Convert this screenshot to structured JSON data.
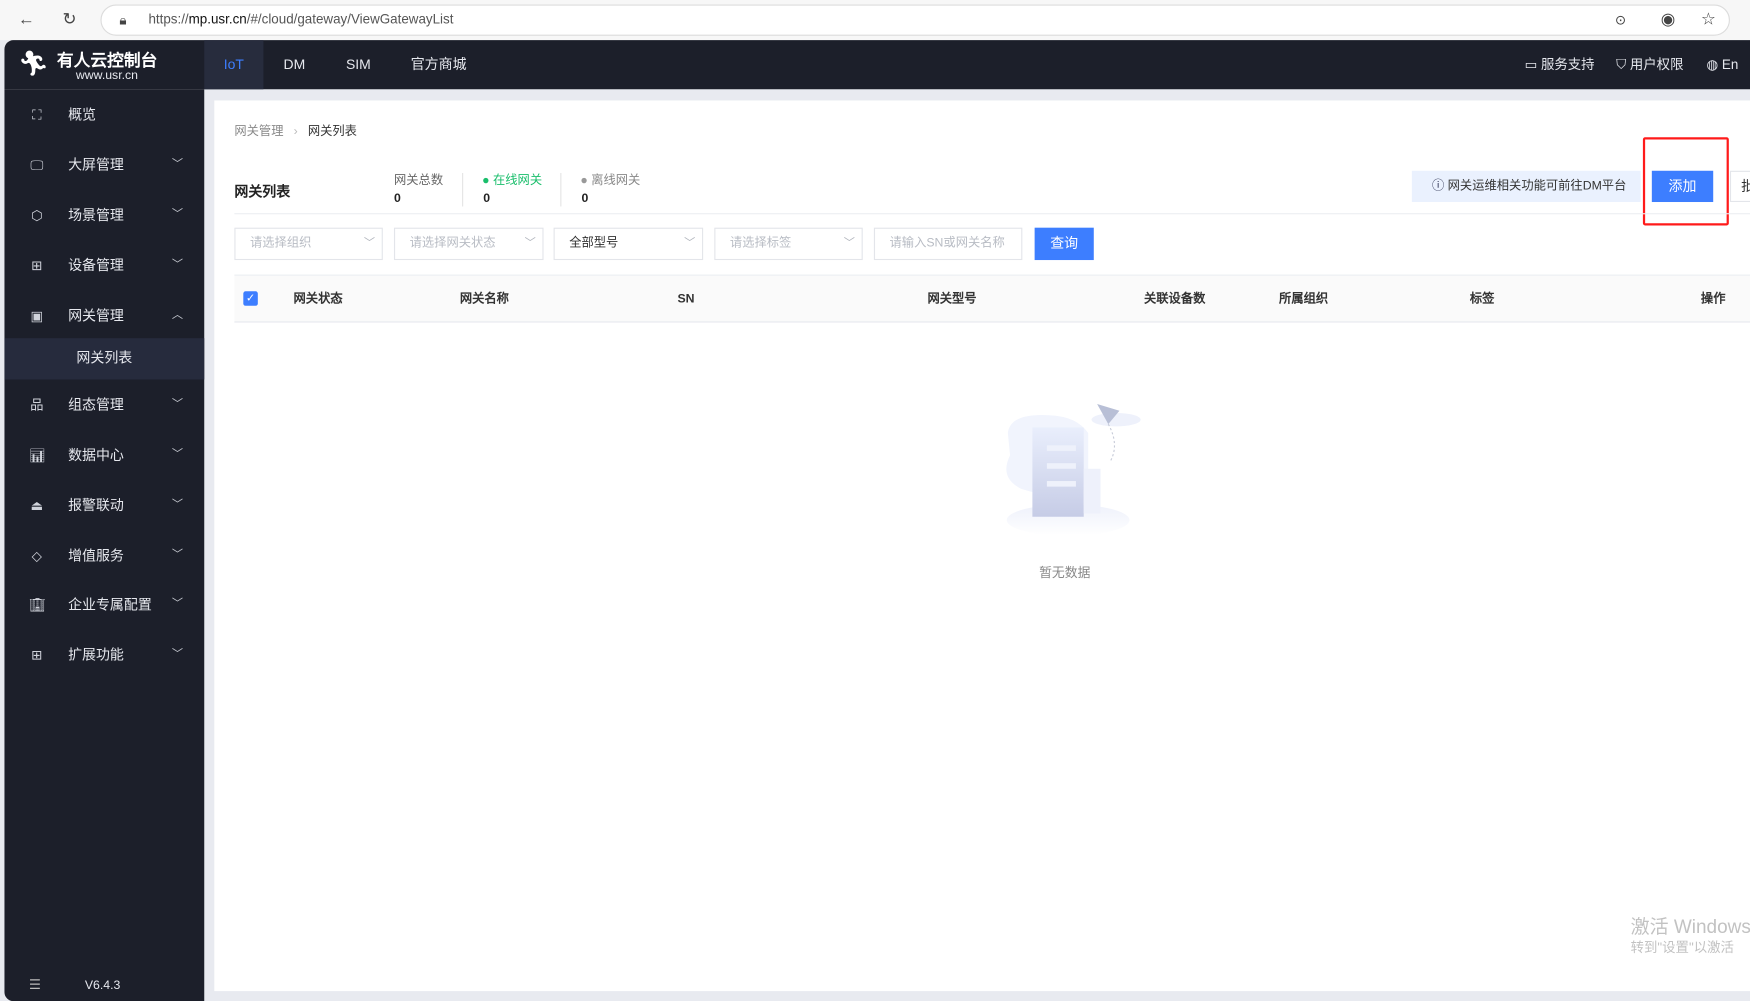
{
  "browser": {
    "url_prefix": "https://",
    "url_host": "mp.usr.cn",
    "url_path": "/#/cloud/gateway/ViewGatewayList"
  },
  "logo": {
    "name": "有人云控制台",
    "site": "www.usr.cn"
  },
  "topnav": {
    "tabs": [
      {
        "label": "IoT",
        "active": true
      },
      {
        "label": "DM"
      },
      {
        "label": "SIM"
      },
      {
        "label": "官方商城"
      }
    ],
    "right": [
      {
        "label": "服务支持",
        "icon": "chat-icon"
      },
      {
        "label": "用户权限",
        "icon": "shield-icon"
      },
      {
        "label": "En",
        "icon": "globe-icon"
      }
    ]
  },
  "sidebar": {
    "items": [
      {
        "label": "概览",
        "icon": "overview-icon"
      },
      {
        "label": "大屏管理",
        "icon": "monitor-icon"
      },
      {
        "label": "场景管理",
        "icon": "cube-icon"
      },
      {
        "label": "设备管理",
        "icon": "device-icon"
      },
      {
        "label": "网关管理",
        "icon": "chart-icon",
        "expanded": true
      },
      {
        "label": "组态管理",
        "icon": "hierarchy-icon"
      },
      {
        "label": "数据中心",
        "icon": "bar-chart-icon"
      },
      {
        "label": "报警联动",
        "icon": "alarm-icon"
      },
      {
        "label": "增值服务",
        "icon": "diamond-icon"
      },
      {
        "label": "企业专属配置",
        "icon": "building-icon"
      },
      {
        "label": "扩展功能",
        "icon": "grid-icon"
      }
    ],
    "sub_item": "网关列表",
    "version": "V6.4.3"
  },
  "breadcrumb": [
    "网关管理",
    "网关列表"
  ],
  "page": {
    "title": "网关列表",
    "stats": [
      {
        "label": "网关总数",
        "value": "0"
      },
      {
        "label": "在线网关",
        "value": "0",
        "color": "#19be6b"
      },
      {
        "label": "离线网关",
        "value": "0",
        "color": "#999999"
      }
    ],
    "info": "网关运维相关功能可前往DM平台",
    "add_label": "添加",
    "batch_label": "批"
  },
  "filters": {
    "org": "请选择组织",
    "status": "请选择网关状态",
    "model": "全部型号",
    "tag": "请选择标签",
    "search_placeholder": "请输入SN或网关名称",
    "query": "查询"
  },
  "table": {
    "columns": [
      "网关状态",
      "网关名称",
      "SN",
      "网关型号",
      "关联设备数",
      "所属组织",
      "标签",
      "操作"
    ],
    "rows": [],
    "empty": "暂无数据"
  },
  "watermark": {
    "line1": "激活 Windows",
    "line2": "转到\"设置\"以激活"
  },
  "colors": {
    "accent": "#3d7eff",
    "nav_bg": "#1c1f2a",
    "highlight": "#ff0000"
  }
}
